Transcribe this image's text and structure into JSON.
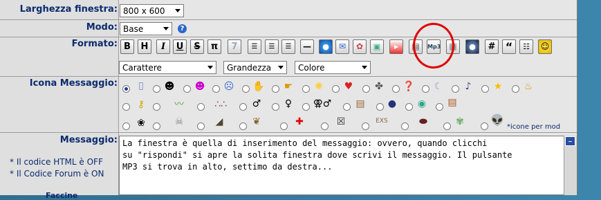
{
  "labels": {
    "window_size": "Larghezza finestra:",
    "mode": "Modo:",
    "format": "Formato:",
    "message_icon": "Icona Messaggio:",
    "message": "Messaggio:",
    "html_status": "* Il codice HTML è OFF",
    "forum_code_status": "* Il Codice Forum è ON",
    "faces_partial": "Faccine"
  },
  "selects": {
    "window_size": "800 x 600",
    "mode": "Base",
    "font": "Carattere",
    "size": "Grandezza",
    "color": "Colore"
  },
  "toolbar": {
    "bold": "B",
    "heading": "H",
    "italic": "I",
    "underline": "U",
    "strike": "S",
    "pi": "π",
    "seven": "7",
    "hash": "#",
    "quote": "“",
    "mp3": "Mp3"
  },
  "icons_note": "*icone per mod",
  "message_text": "La finestra è quella di inserimento del messaggio: ovvero, quando clicchi\nsu \"rispondi\" si apre la solita finestra dove scrivi il messaggio. Il pulsante\nMP3 si trova in alto, settimo da destra...",
  "colors": {
    "label": "#0b2b6d",
    "highlight_circle": "#e10000",
    "background": "#3c86ad"
  }
}
